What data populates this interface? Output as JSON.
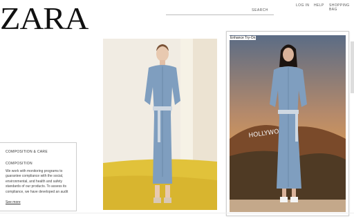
{
  "brand": {
    "logo": "ZARA"
  },
  "header": {
    "search_label": "SEARCH",
    "nav": {
      "login": "LOG IN",
      "help": "HELP",
      "bag": "SHOPPING BAG"
    }
  },
  "product": {
    "image_alt": "Model wearing light blue denim shirt dress with belt on yellow runway"
  },
  "tryon": {
    "label": "Enhance Try-On",
    "image_alt": "Woman wearing the same denim shirt dress in front of Hollywood sign hills at sunset"
  },
  "info": {
    "title": "COMPOSITION & CARE",
    "subtitle": "COMPOSITION",
    "text": "We work with monitoring programs to guarantee compliance with the social, environmental, and health and safety standards of our products. To assess its compliance, we have developed an audit",
    "link": "See more"
  },
  "colors": {
    "denim": "#7f9ebf",
    "sky": "#c58a55",
    "yellow": "#e1c23a"
  }
}
